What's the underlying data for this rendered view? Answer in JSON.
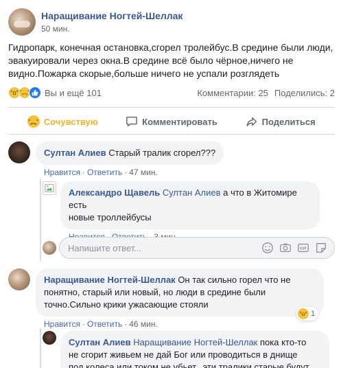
{
  "post": {
    "page_name": "Наращивание Ногтей-Шеллак",
    "time": "50 мин.",
    "text": "Гидропарк, конечная остановка,сгорел тролейбус.В средине были люди, эвакуировали через окна.В средине всё было чёрное,ничего не видно.Пожарка скорые,больше ничего не успали розглядеть",
    "reactions_label": "Вы и ещё 101",
    "comments_count": "Комментарии: 25",
    "shares_count": "Поделились: 2"
  },
  "actions": {
    "sympathy": "Сочувствую",
    "comment": "Комментировать",
    "share": "Поделиться"
  },
  "comments": [
    {
      "author": "Султан Алиев",
      "text": "Старый тралик сгорел???",
      "like": "Нравится",
      "reply": "Ответить",
      "time": "47 мин."
    },
    {
      "author": "Александро Щавель",
      "mention": "Султан Алиев",
      "text_line1": " а что в Житомире есть",
      "text_line2": "новые троллейбусы",
      "like": "Нравится",
      "reply": "Ответить",
      "time": "3 мин."
    },
    {
      "author": "Наращивание Ногтей-Шеллак",
      "text_line1": " Он так сильно горел что не",
      "text_line2": "понятно, старый или новый, но люди в средине были",
      "text_line3": "точно.Сильно крики ужасающие стояли",
      "like": "Нравится",
      "reply": "Ответить",
      "time": "46 мин.",
      "reaction_count": "1"
    },
    {
      "author": "Султан Алиев",
      "mention": "Наращивание Ногтей-Шеллак",
      "text_line1": " пока кто-то",
      "text_line2": "не сгорит живьем не дай Бог или проводиться в днище",
      "text_line3": "под колеса или током не убьет...эти тралики старые будут"
    }
  ],
  "reply_input": {
    "placeholder": "Напишите ответ..."
  },
  "colors": {
    "link_blue": "#385898",
    "sympathy_yellow": "#f7b125",
    "bubble_bg": "#f2f3f5",
    "muted": "#606770"
  },
  "icons": [
    "wow-reaction-icon",
    "sad-reaction-icon",
    "like-reaction-icon",
    "comment-icon",
    "share-icon",
    "emoji-icon",
    "camera-icon",
    "gif-icon",
    "sticker-icon"
  ]
}
